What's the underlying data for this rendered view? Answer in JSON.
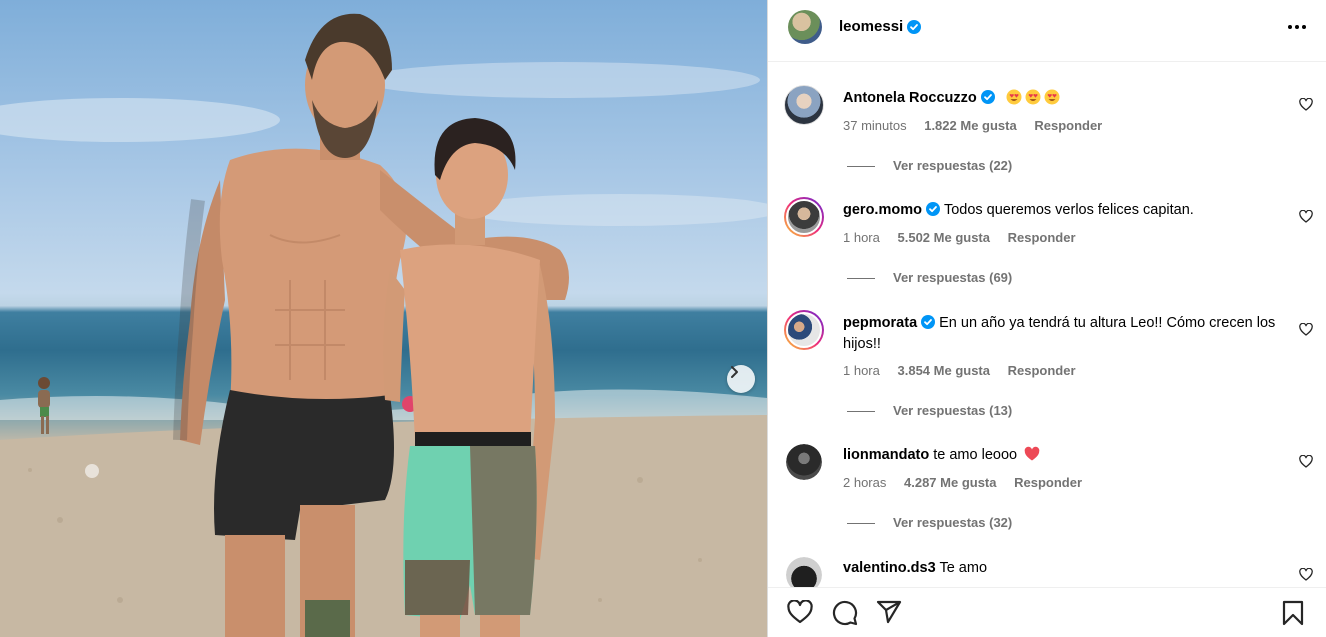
{
  "post": {
    "author": "leomessi"
  },
  "comments": [
    {
      "user": "Antonela Roccuzzo",
      "text": "",
      "emoji_count": 3,
      "time": "37 minutos",
      "likes": "1.822 Me gusta",
      "reply": "Responder",
      "view_replies": "Ver respuestas (22)"
    },
    {
      "user": "gero.momo",
      "text": "Todos queremos verlos felices capitan.",
      "time": "1 hora",
      "likes": "5.502 Me gusta",
      "reply": "Responder",
      "view_replies": "Ver respuestas (69)"
    },
    {
      "user": "pepmorata",
      "text": "En un año ya tendrá tu altura Leo!! Cómo crecen los hijos!!",
      "time": "1 hora",
      "likes": "3.854 Me gusta",
      "reply": "Responder",
      "view_replies": "Ver respuestas (13)"
    },
    {
      "user": "lionmandato",
      "text": "te amo leooo",
      "time": "2 horas",
      "likes": "4.287 Me gusta",
      "reply": "Responder",
      "view_replies": "Ver respuestas (32)"
    },
    {
      "user": "valentino.ds3",
      "text": "Te amo"
    }
  ],
  "icons": {
    "like": "heart-icon",
    "comment": "comment-icon",
    "share": "share-icon",
    "save": "bookmark-icon",
    "more": "more-options-icon",
    "next": "chevron-right-icon",
    "verified": "verified-badge-icon"
  },
  "colors": {
    "verified": "#0095f6",
    "meta_text": "#737373",
    "heart_emoji": "#ed4956"
  }
}
